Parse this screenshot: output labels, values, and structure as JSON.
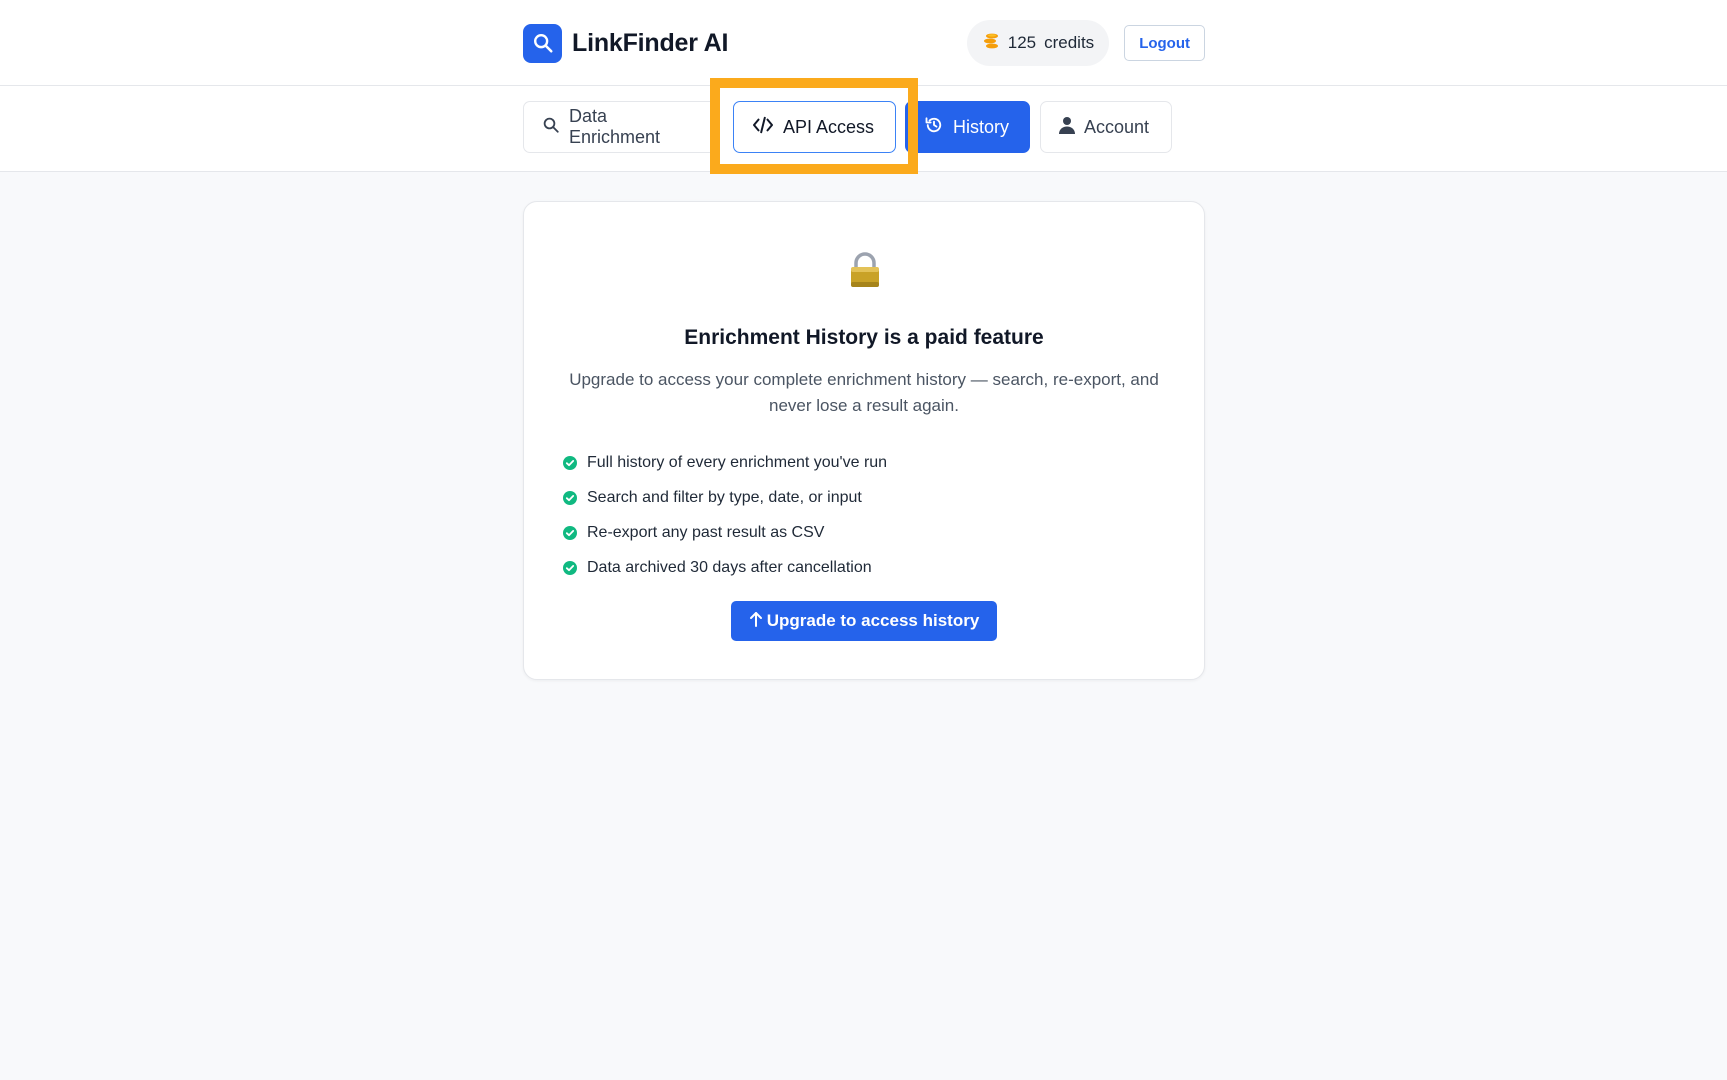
{
  "header": {
    "brand_name": "LinkFinder AI",
    "credits_count": "125",
    "credits_label": "credits",
    "logout_label": "Logout"
  },
  "nav": {
    "tabs": [
      {
        "label": "Data Enrichment",
        "icon": "search-icon",
        "active": false
      },
      {
        "label": "API Access",
        "icon": "code-icon",
        "active": false,
        "focused": true
      },
      {
        "label": "History",
        "icon": "history-icon",
        "active": true
      },
      {
        "label": "Account",
        "icon": "user-icon",
        "active": false
      }
    ]
  },
  "paywall": {
    "icon": "lock-icon",
    "title": "Enrichment History is a paid feature",
    "description": "Upgrade to access your complete enrichment history — search, re-export, and never lose a result again.",
    "features": [
      "Full history of every enrichment you've run",
      "Search and filter by type, date, or input",
      "Re-export any past result as CSV",
      "Data archived 30 days after cancellation"
    ],
    "upgrade_label": "Upgrade to access history"
  },
  "colors": {
    "accent": "#2563eb",
    "check": "#10b981",
    "highlight": "#fbaa1c"
  }
}
